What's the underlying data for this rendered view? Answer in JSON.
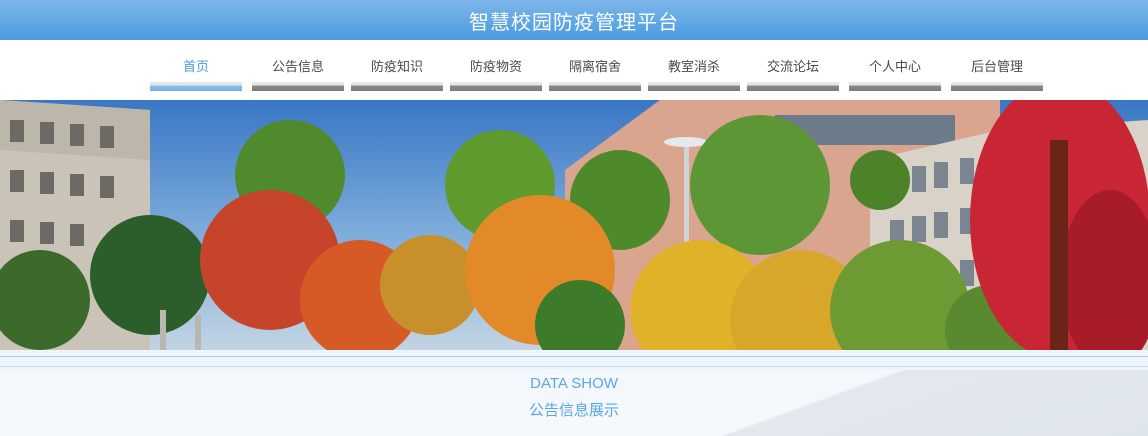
{
  "header": {
    "title": "智慧校园防疫管理平台"
  },
  "nav": {
    "items": [
      {
        "label": "首页",
        "active": true
      },
      {
        "label": "公告信息",
        "active": false
      },
      {
        "label": "防疫知识",
        "active": false
      },
      {
        "label": "防疫物资",
        "active": false
      },
      {
        "label": "隔离宿舍",
        "active": false
      },
      {
        "label": "教室消杀",
        "active": false
      },
      {
        "label": "交流论坛",
        "active": false
      },
      {
        "label": "个人中心",
        "active": false
      },
      {
        "label": "后台管理",
        "active": false
      }
    ]
  },
  "section": {
    "en_title": "DATA SHOW",
    "zh_title": "公告信息展示"
  },
  "colors": {
    "accent": "#4a9be0",
    "title_bar": "#5aa6e6",
    "nav_bar": "#7a7a7a"
  }
}
